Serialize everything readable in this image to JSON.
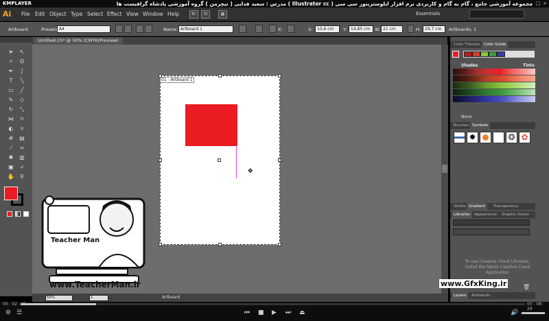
{
  "player": {
    "brand": "KMPLAYER",
    "video_title": "مجموعه آموزشی جامع ، گام به گام و کاربردی نرم افزار ایلوستریتور سی سی ( Illustrator cc )   مدرس : سعید فدایی ( تیچرمن ) گروه آموزشی پادشاه گرافیست ها",
    "time_current": "00 : 02 : 25",
    "time_total": "00 : 08 : 29"
  },
  "app": {
    "logo": "Ai",
    "menus": [
      "File",
      "Edit",
      "Object",
      "Type",
      "Select",
      "Effect",
      "View",
      "Window",
      "Help"
    ],
    "workspace": "Essentials"
  },
  "control_bar": {
    "mode": "Artboard",
    "presets_label": "Presets:",
    "preset_value": "A4",
    "name_label": "Name:",
    "name_value": "Artboard 1",
    "x_label": "X:",
    "x_value": "10,6 cm",
    "y_label": "Y:",
    "y_value": "14,85 cm",
    "w_label": "W:",
    "w_value": "21 cm",
    "h_label": "H:",
    "h_value": "29,7 cm",
    "artboards_label": "Artboards:",
    "artboards_value": "1"
  },
  "document": {
    "tab_label": "Untitled-15* @ 50% (CMYK/Preview)",
    "artboard_label": "01 - Artboard 1",
    "zoom": "50%",
    "page": "1",
    "status": "Artboard",
    "rect_color": "#ec1c24"
  },
  "panels": {
    "color_tabs": [
      "Color Themes",
      "Color Guide"
    ],
    "shades_label": "Shades",
    "tints_label": "Tints",
    "none_label": "None",
    "brushes_tabs": [
      "Brushes",
      "Symbols"
    ],
    "stroke_tabs": [
      "Stroke",
      "Gradient",
      "Transparency"
    ],
    "lib_tabs": [
      "Libraries",
      "Appearance",
      "Graphic Styles"
    ],
    "lib_msg": "To use Creative Cloud Libraries, install the latest Creative Cloud Application",
    "bottom_tabs": [
      "Layers",
      "Artboards"
    ]
  },
  "watermarks": {
    "teacher_name": "Teacher Man",
    "teacher_url": "www.TeacherMan.ir",
    "gfx_url": "www.GfxKing.ir"
  }
}
